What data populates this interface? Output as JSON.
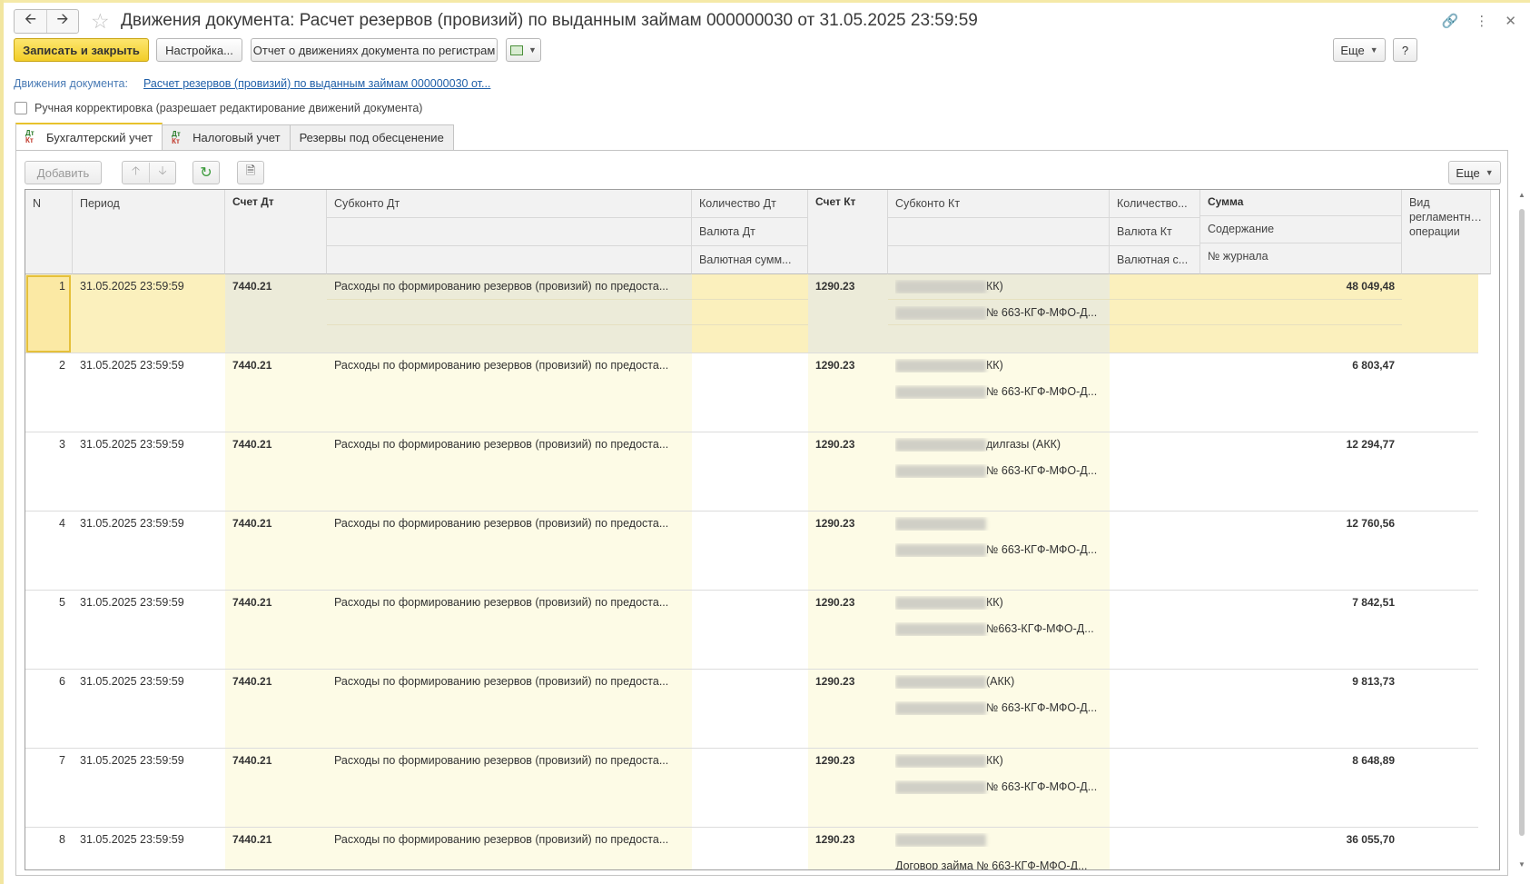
{
  "window": {
    "title": "Движения документа: Расчет резервов (провизий) по выданным займам 000000030 от 31.05.2025 23:59:59",
    "back_icon": "arrow-left-icon",
    "forward_icon": "arrow-right-icon",
    "star_icon": "star-icon",
    "link_icon": "link-icon",
    "menu_icon": "more-vertical-icon",
    "close_icon": "close-icon"
  },
  "toolbar": {
    "save_close": "Записать и закрыть",
    "settings": "Настройка...",
    "report": "Отчет о движениях документа по регистрам",
    "more": "Еще",
    "help": "?"
  },
  "doc_link": {
    "label": "Движения документа:",
    "text": "Расчет резервов (провизий) по выданным займам 000000030 от..."
  },
  "manual_edit": {
    "label": "Ручная корректировка (разрешает редактирование движений документа)",
    "checked": false
  },
  "tabs": [
    {
      "label": "Бухгалтерский учет",
      "active": true
    },
    {
      "label": "Налоговый учет",
      "active": false
    },
    {
      "label": "Резервы под обесценение",
      "active": false
    }
  ],
  "table_toolbar": {
    "add": "Добавить",
    "more": "Еще"
  },
  "columns": {
    "n": "N",
    "period": "Период",
    "account_dt": "Счет Дт",
    "subconto_dt": "Субконто Дт",
    "qty_dt": "Количество Дт",
    "currency_dt": "Валюта Дт",
    "cur_sum_dt": "Валютная сумм...",
    "account_kt": "Счет Кт",
    "subconto_kt": "Субконто Кт",
    "qty_kt": "Количество...",
    "currency_kt": "Валюта Кт",
    "cur_sum_kt": "Валютная с...",
    "sum": "Сумма",
    "content": "Содержание",
    "journal": "№ журнала",
    "operation_type": "Вид регламентной операции"
  },
  "rows": [
    {
      "n": "1",
      "period": "31.05.2025 23:59:59",
      "dt": "7440.21",
      "subconto_dt": "Расходы по формированию резервов (провизий) по предоста...",
      "kt": "1290.23",
      "kt_line1": "КК)",
      "kt_line2": "№ 663-КГФ-МФО-Д...",
      "sum": "48 049,48"
    },
    {
      "n": "2",
      "period": "31.05.2025 23:59:59",
      "dt": "7440.21",
      "subconto_dt": "Расходы по формированию резервов (провизий) по предоста...",
      "kt": "1290.23",
      "kt_line1": "КК)",
      "kt_line2": "№ 663-КГФ-МФО-Д...",
      "sum": "6 803,47"
    },
    {
      "n": "3",
      "period": "31.05.2025 23:59:59",
      "dt": "7440.21",
      "subconto_dt": "Расходы по формированию резервов (провизий) по предоста...",
      "kt": "1290.23",
      "kt_line1": "дилгазы (АКК)",
      "kt_line2": "№ 663-КГФ-МФО-Д...",
      "sum": "12 294,77"
    },
    {
      "n": "4",
      "period": "31.05.2025 23:59:59",
      "dt": "7440.21",
      "subconto_dt": "Расходы по формированию резервов (провизий) по предоста...",
      "kt": "1290.23",
      "kt_line1": "",
      "kt_line2": "№ 663-КГФ-МФО-Д...",
      "sum": "12 760,56"
    },
    {
      "n": "5",
      "period": "31.05.2025 23:59:59",
      "dt": "7440.21",
      "subconto_dt": "Расходы по формированию резервов (провизий) по предоста...",
      "kt": "1290.23",
      "kt_line1": "КК)",
      "kt_line2": "№663-КГФ-МФО-Д...",
      "sum": "7 842,51"
    },
    {
      "n": "6",
      "period": "31.05.2025 23:59:59",
      "dt": "7440.21",
      "subconto_dt": "Расходы по формированию резервов (провизий) по предоста...",
      "kt": "1290.23",
      "kt_line1": "(АКК)",
      "kt_line2": "№ 663-КГФ-МФО-Д...",
      "sum": "9 813,73"
    },
    {
      "n": "7",
      "period": "31.05.2025 23:59:59",
      "dt": "7440.21",
      "subconto_dt": "Расходы по формированию резервов (провизий) по предоста...",
      "kt": "1290.23",
      "kt_line1": "КК)",
      "kt_line2": "№ 663-КГФ-МФО-Д...",
      "sum": "8 648,89"
    },
    {
      "n": "8",
      "period": "31.05.2025 23:59:59",
      "dt": "7440.21",
      "subconto_dt": "Расходы по формированию резервов (провизий) по предоста...",
      "kt": "1290.23",
      "kt_line1": "",
      "kt_line2": "Договор займа № 663-КГФ-МФО-Д...",
      "sum": "36 055,70"
    }
  ],
  "colors": {
    "primary_button": "#f2cd28",
    "selected_row": "#fbf0bd",
    "shaded_column": "#fdfbe6",
    "link": "#1f5fa8"
  }
}
